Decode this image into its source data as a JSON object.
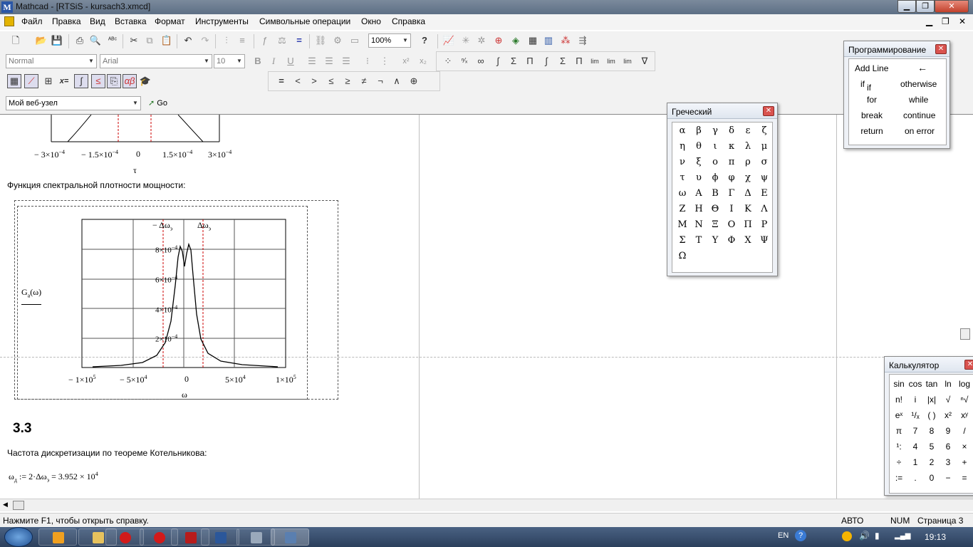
{
  "window": {
    "app": "Mathcad",
    "title": "Mathcad - [RTSiS - kursach3.xmcd]",
    "icon": "M"
  },
  "menu": [
    "Файл",
    "Правка",
    "Вид",
    "Вставка",
    "Формат",
    "Инструменты",
    "Символьные операции",
    "Окно",
    "Справка"
  ],
  "toolbar": {
    "zoom": "100%",
    "style": "Normal",
    "font": "Arial",
    "size": "10",
    "url": "Мой веб-узел",
    "go": "Go"
  },
  "math_toolbar": [
    "=",
    "<",
    ">",
    "≤",
    "≥",
    "≠",
    "¬",
    "∧",
    "⊕"
  ],
  "doc": {
    "top_axis": {
      "ticks": [
        "− 3×10",
        "− 1.5×10",
        "0",
        "1.5×10",
        "3×10"
      ],
      "exp": "−4",
      "label": "τ"
    },
    "psd_heading": "Функция спектральной плотности мощности:",
    "plot": {
      "ylabel_fn": "G",
      "ylabel_sub": "a",
      "ylabel_arg": "(ω)",
      "xlabel": "ω",
      "yticks": [
        "8×10",
        "6×10",
        "4×10",
        "2×10"
      ],
      "yexp": "−4",
      "xticks": [
        "− 1×10",
        "− 5×10",
        "0",
        "5×10",
        "1×10"
      ],
      "xexps": [
        "5",
        "4",
        "",
        "4",
        "5"
      ],
      "marker_neg": "− Δω",
      "marker_pos": "Δω",
      "marker_sub": "э"
    },
    "section": "3.3",
    "kotel": "Частота дискретизации по теореме Котельникова:",
    "formula": {
      "lhs": "ω",
      "lhs_sub": "д",
      "def": " := 2·Δω",
      "def_sub": "э",
      "res": " = 3.952 × 10",
      "res_exp": "4"
    }
  },
  "greek": {
    "title": "Греческий",
    "symbols": [
      "α",
      "β",
      "γ",
      "δ",
      "ε",
      "ζ",
      "η",
      "θ",
      "ι",
      "κ",
      "λ",
      "μ",
      "ν",
      "ξ",
      "ο",
      "π",
      "ρ",
      "σ",
      "τ",
      "υ",
      "ϕ",
      "φ",
      "χ",
      "ψ",
      "ω",
      "Α",
      "Β",
      "Γ",
      "Δ",
      "Ε",
      "Ζ",
      "Η",
      "Θ",
      "Ι",
      "Κ",
      "Λ",
      "Μ",
      "Ν",
      "Ξ",
      "Ο",
      "Π",
      "Ρ",
      "Σ",
      "Τ",
      "Υ",
      "Φ",
      "Χ",
      "Ψ",
      "Ω"
    ]
  },
  "prog": {
    "title": "Программирование",
    "items": [
      "Add Line",
      "←",
      "if",
      "otherwise",
      "for",
      "while",
      "break",
      "continue",
      "return",
      "on error"
    ]
  },
  "calc": {
    "title": "Калькулятор",
    "rows": [
      [
        "sin",
        "cos",
        "tan",
        "ln",
        "log"
      ],
      [
        "n!",
        "i",
        "|x|",
        "√",
        "ⁿ√"
      ],
      [
        "eˣ",
        "¹/ₓ",
        "( )",
        "x²",
        "xʸ"
      ],
      [
        "π",
        "7",
        "8",
        "9",
        "/"
      ],
      [
        "¹:",
        "4",
        "5",
        "6",
        "×"
      ],
      [
        "÷",
        "1",
        "2",
        "3",
        "+"
      ],
      [
        ":=",
        ".",
        "0",
        "−",
        "="
      ]
    ]
  },
  "status": {
    "help": "Нажмите F1, чтобы открыть справку.",
    "mode": "АВТО",
    "num": "NUM",
    "page": "Страница 3"
  },
  "tray": {
    "lang": "EN",
    "time": "19:13"
  }
}
